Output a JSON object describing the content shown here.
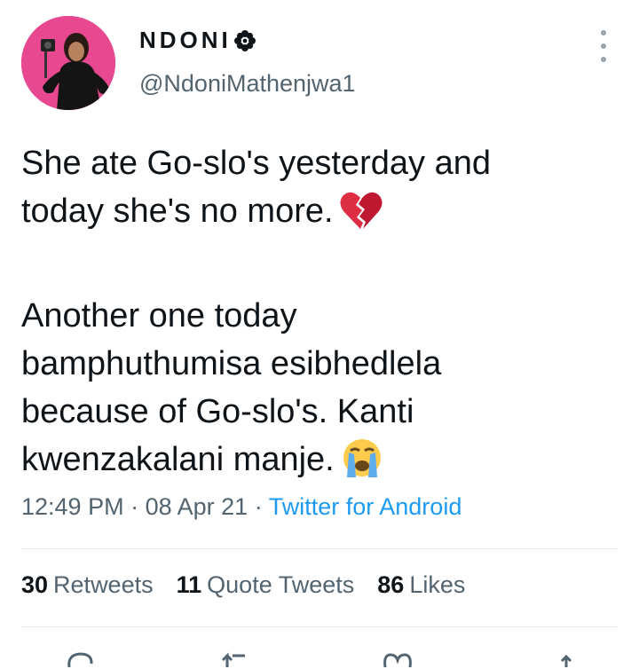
{
  "author": {
    "display_name": "NDONI",
    "handle": "@NdoniMathenjwa1"
  },
  "tweet": {
    "line1": "She ate Go-slo's yesterday and",
    "line2": "today she's no more.",
    "line3": "Another one today",
    "line4": "bamphuthumisa esibhedlela",
    "line5": "because of Go-slo's. Kanti",
    "line6": "kwenzakalani manje.",
    "emoji1": "broken-heart-icon",
    "emoji2": "loudly-crying-face-icon"
  },
  "meta": {
    "time": "12:49 PM",
    "separator": "·",
    "date": "08 Apr 21",
    "source": "Twitter for Android"
  },
  "stats": {
    "retweets_count": "30",
    "retweets_label": "Retweets",
    "quotes_count": "11",
    "quotes_label": "Quote Tweets",
    "likes_count": "86",
    "likes_label": "Likes"
  },
  "colors": {
    "accent": "#1d9bf0",
    "secondary_text": "#536471",
    "primary_text": "#0f1419"
  }
}
